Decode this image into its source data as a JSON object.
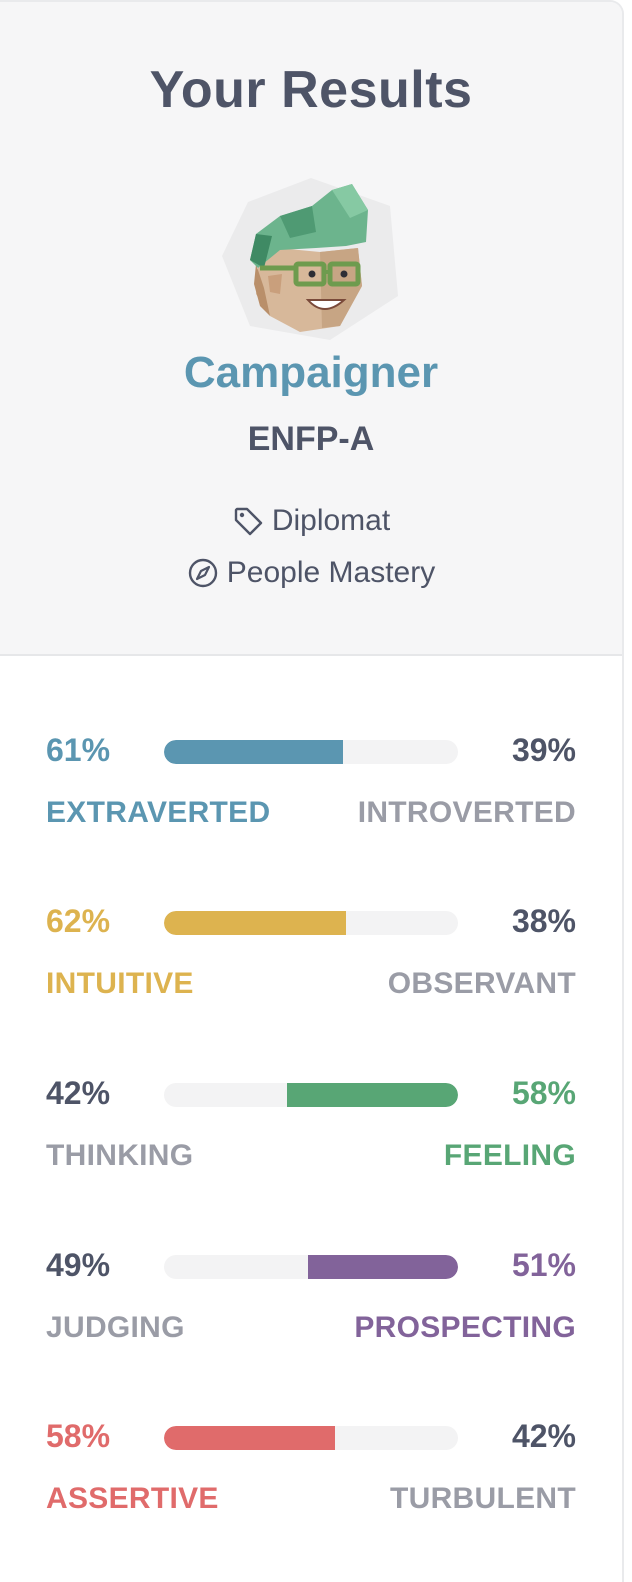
{
  "header": {
    "title": "Your Results",
    "type_name": "Campaigner",
    "type_code": "ENFP-A",
    "role": "Diplomat",
    "strategy": "People Mastery",
    "role_icon": "tag-icon",
    "strategy_icon": "compass-icon"
  },
  "colors": {
    "text_dark": "#4e5467",
    "text_muted": "#9a9ca6",
    "mind": "#5b96b1",
    "energy": "#ddb34f",
    "nature": "#58a675",
    "tactics": "#82639a",
    "identity": "#e06b6b",
    "track": "#f3f3f4"
  },
  "traits": [
    {
      "left_pct": "61%",
      "right_pct": "39%",
      "left_label": "EXTRAVERTED",
      "right_label": "INTROVERTED",
      "dominant": "left",
      "value": 0.61,
      "color": "#5b96b1"
    },
    {
      "left_pct": "62%",
      "right_pct": "38%",
      "left_label": "INTUITIVE",
      "right_label": "OBSERVANT",
      "dominant": "left",
      "value": 0.62,
      "color": "#ddb34f"
    },
    {
      "left_pct": "42%",
      "right_pct": "58%",
      "left_label": "THINKING",
      "right_label": "FEELING",
      "dominant": "right",
      "value": 0.58,
      "color": "#58a675"
    },
    {
      "left_pct": "49%",
      "right_pct": "51%",
      "left_label": "JUDGING",
      "right_label": "PROSPECTING",
      "dominant": "right",
      "value": 0.51,
      "color": "#82639a"
    },
    {
      "left_pct": "58%",
      "right_pct": "42%",
      "left_label": "ASSERTIVE",
      "right_label": "TURBULENT",
      "dominant": "left",
      "value": 0.58,
      "color": "#e06b6b"
    }
  ]
}
